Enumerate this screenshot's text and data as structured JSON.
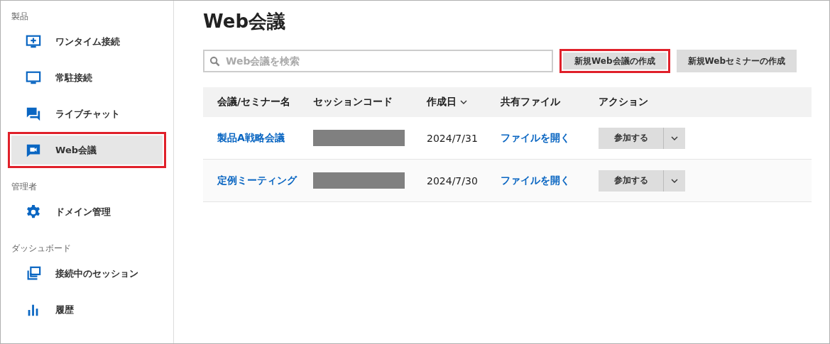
{
  "sidebar": {
    "sections": [
      {
        "label": "製品",
        "items": [
          {
            "label": "ワンタイム接続",
            "selected": false,
            "highlighted": false
          },
          {
            "label": "常駐接続",
            "selected": false,
            "highlighted": false
          },
          {
            "label": "ライブチャット",
            "selected": false,
            "highlighted": false
          },
          {
            "label": "Web会議",
            "selected": true,
            "highlighted": true
          }
        ]
      },
      {
        "label": "管理者",
        "items": [
          {
            "label": "ドメイン管理",
            "selected": false,
            "highlighted": false
          }
        ]
      },
      {
        "label": "ダッシュボード",
        "items": [
          {
            "label": "接続中のセッション",
            "selected": false,
            "highlighted": false
          },
          {
            "label": "履歴",
            "selected": false,
            "highlighted": false
          }
        ]
      }
    ]
  },
  "page_title": "Web会議",
  "search": {
    "placeholder": "Web会議を検索"
  },
  "buttons": [
    {
      "label": "新規Web会議の作成",
      "highlighted": true
    },
    {
      "label": "新規Webセミナーの作成",
      "highlighted": false
    }
  ],
  "table": {
    "columns": [
      {
        "label": "会議/セミナー名",
        "sortable": false
      },
      {
        "label": "セッションコード",
        "sortable": false
      },
      {
        "label": "作成日",
        "sortable": true
      },
      {
        "label": "共有ファイル",
        "sortable": false
      },
      {
        "label": "アクション",
        "sortable": false
      }
    ],
    "rows": [
      {
        "name": "製品A戦略会議",
        "created": "2024/7/31",
        "file_link": "ファイルを開く",
        "action": "参加する"
      },
      {
        "name": "定例ミーティング",
        "created": "2024/7/30",
        "file_link": "ファイルを開く",
        "action": "参加する"
      }
    ]
  }
}
